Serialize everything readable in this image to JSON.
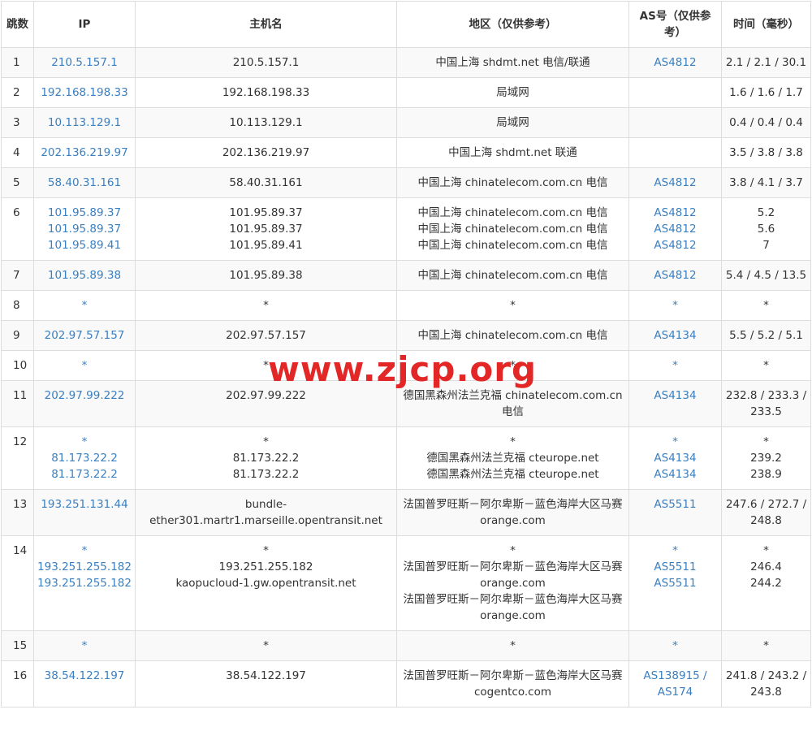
{
  "headers": [
    "跳数",
    "IP",
    "主机名",
    "地区（仅供参考）",
    "AS号（仅供参考）",
    "时间（毫秒）"
  ],
  "rows": [
    {
      "hop": "1",
      "ip": [
        "210.5.157.1"
      ],
      "host": [
        "210.5.157.1"
      ],
      "region": [
        "中国上海 shdmt.net 电信/联通"
      ],
      "asn": [
        "AS4812"
      ],
      "time": [
        "2.1 / 2.1 / 30.1"
      ]
    },
    {
      "hop": "2",
      "ip": [
        "192.168.198.33"
      ],
      "host": [
        "192.168.198.33"
      ],
      "region": [
        "局域网"
      ],
      "asn": [
        ""
      ],
      "time": [
        "1.6 / 1.6 / 1.7"
      ]
    },
    {
      "hop": "3",
      "ip": [
        "10.113.129.1"
      ],
      "host": [
        "10.113.129.1"
      ],
      "region": [
        "局域网"
      ],
      "asn": [
        ""
      ],
      "time": [
        "0.4 / 0.4 / 0.4"
      ]
    },
    {
      "hop": "4",
      "ip": [
        "202.136.219.97"
      ],
      "host": [
        "202.136.219.97"
      ],
      "region": [
        "中国上海 shdmt.net 联通"
      ],
      "asn": [
        ""
      ],
      "time": [
        "3.5 / 3.8 / 3.8"
      ]
    },
    {
      "hop": "5",
      "ip": [
        "58.40.31.161"
      ],
      "host": [
        "58.40.31.161"
      ],
      "region": [
        "中国上海 chinatelecom.com.cn 电信"
      ],
      "asn": [
        "AS4812"
      ],
      "time": [
        "3.8 / 4.1 / 3.7"
      ]
    },
    {
      "hop": "6",
      "ip": [
        "101.95.89.37",
        "101.95.89.37",
        "101.95.89.41"
      ],
      "host": [
        "101.95.89.37",
        "101.95.89.37",
        "101.95.89.41"
      ],
      "region": [
        "中国上海 chinatelecom.com.cn 电信",
        "中国上海 chinatelecom.com.cn 电信",
        "中国上海 chinatelecom.com.cn 电信"
      ],
      "asn": [
        "AS4812",
        "AS4812",
        "AS4812"
      ],
      "time": [
        "5.2",
        "5.6",
        "7"
      ]
    },
    {
      "hop": "7",
      "ip": [
        "101.95.89.38"
      ],
      "host": [
        "101.95.89.38"
      ],
      "region": [
        "中国上海 chinatelecom.com.cn 电信"
      ],
      "asn": [
        "AS4812"
      ],
      "time": [
        "5.4 / 4.5 / 13.5"
      ]
    },
    {
      "hop": "8",
      "ip": [
        "*"
      ],
      "host": [
        "*"
      ],
      "region": [
        "*"
      ],
      "asn": [
        "*"
      ],
      "time": [
        "*"
      ]
    },
    {
      "hop": "9",
      "ip": [
        "202.97.57.157"
      ],
      "host": [
        "202.97.57.157"
      ],
      "region": [
        "中国上海 chinatelecom.com.cn 电信"
      ],
      "asn": [
        "AS4134"
      ],
      "time": [
        "5.5 / 5.2 / 5.1"
      ]
    },
    {
      "hop": "10",
      "ip": [
        "*"
      ],
      "host": [
        "*"
      ],
      "region": [
        "*"
      ],
      "asn": [
        "*"
      ],
      "time": [
        "*"
      ]
    },
    {
      "hop": "11",
      "ip": [
        "202.97.99.222"
      ],
      "host": [
        "202.97.99.222"
      ],
      "region": [
        "德国黑森州法兰克福 chinatelecom.com.cn 电信"
      ],
      "asn": [
        "AS4134"
      ],
      "time": [
        "232.8 / 233.3 / 233.5"
      ]
    },
    {
      "hop": "12",
      "ip": [
        "*",
        "81.173.22.2",
        "81.173.22.2"
      ],
      "host": [
        "*",
        "81.173.22.2",
        "81.173.22.2"
      ],
      "region": [
        "*",
        "德国黑森州法兰克福 cteurope.net",
        "德国黑森州法兰克福 cteurope.net"
      ],
      "asn": [
        "*",
        "AS4134",
        "AS4134"
      ],
      "time": [
        "*",
        "239.2",
        "238.9"
      ]
    },
    {
      "hop": "13",
      "ip": [
        "193.251.131.44"
      ],
      "host": [
        "bundle-ether301.martr1.marseille.opentransit.net"
      ],
      "region": [
        "法国普罗旺斯－阿尔卑斯－蓝色海岸大区马赛 orange.com"
      ],
      "asn": [
        "AS5511"
      ],
      "time": [
        "247.6 / 272.7 / 248.8"
      ]
    },
    {
      "hop": "14",
      "ip": [
        "*",
        "193.251.255.182",
        "193.251.255.182"
      ],
      "host": [
        "*",
        "193.251.255.182",
        "kaopucloud-1.gw.opentransit.net"
      ],
      "region": [
        "*",
        "法国普罗旺斯－阿尔卑斯－蓝色海岸大区马赛 orange.com",
        "法国普罗旺斯－阿尔卑斯－蓝色海岸大区马赛 orange.com"
      ],
      "asn": [
        "*",
        "AS5511",
        "AS5511"
      ],
      "time": [
        "*",
        "246.4",
        "244.2"
      ]
    },
    {
      "hop": "15",
      "ip": [
        "*"
      ],
      "host": [
        "*"
      ],
      "region": [
        "*"
      ],
      "asn": [
        "*"
      ],
      "time": [
        "*"
      ]
    },
    {
      "hop": "16",
      "ip": [
        "38.54.122.197"
      ],
      "host": [
        "38.54.122.197"
      ],
      "region": [
        "法国普罗旺斯－阿尔卑斯－蓝色海岸大区马赛 cogentco.com"
      ],
      "asn": [
        "AS138915 / AS174"
      ],
      "time": [
        "241.8 / 243.2 / 243.8"
      ]
    }
  ],
  "watermark": "www.zjcp.org",
  "colors": {
    "link": "#3a7fc0",
    "border": "#dddddd",
    "stripe": "#f9f9f9",
    "watermark": "#e32626"
  }
}
